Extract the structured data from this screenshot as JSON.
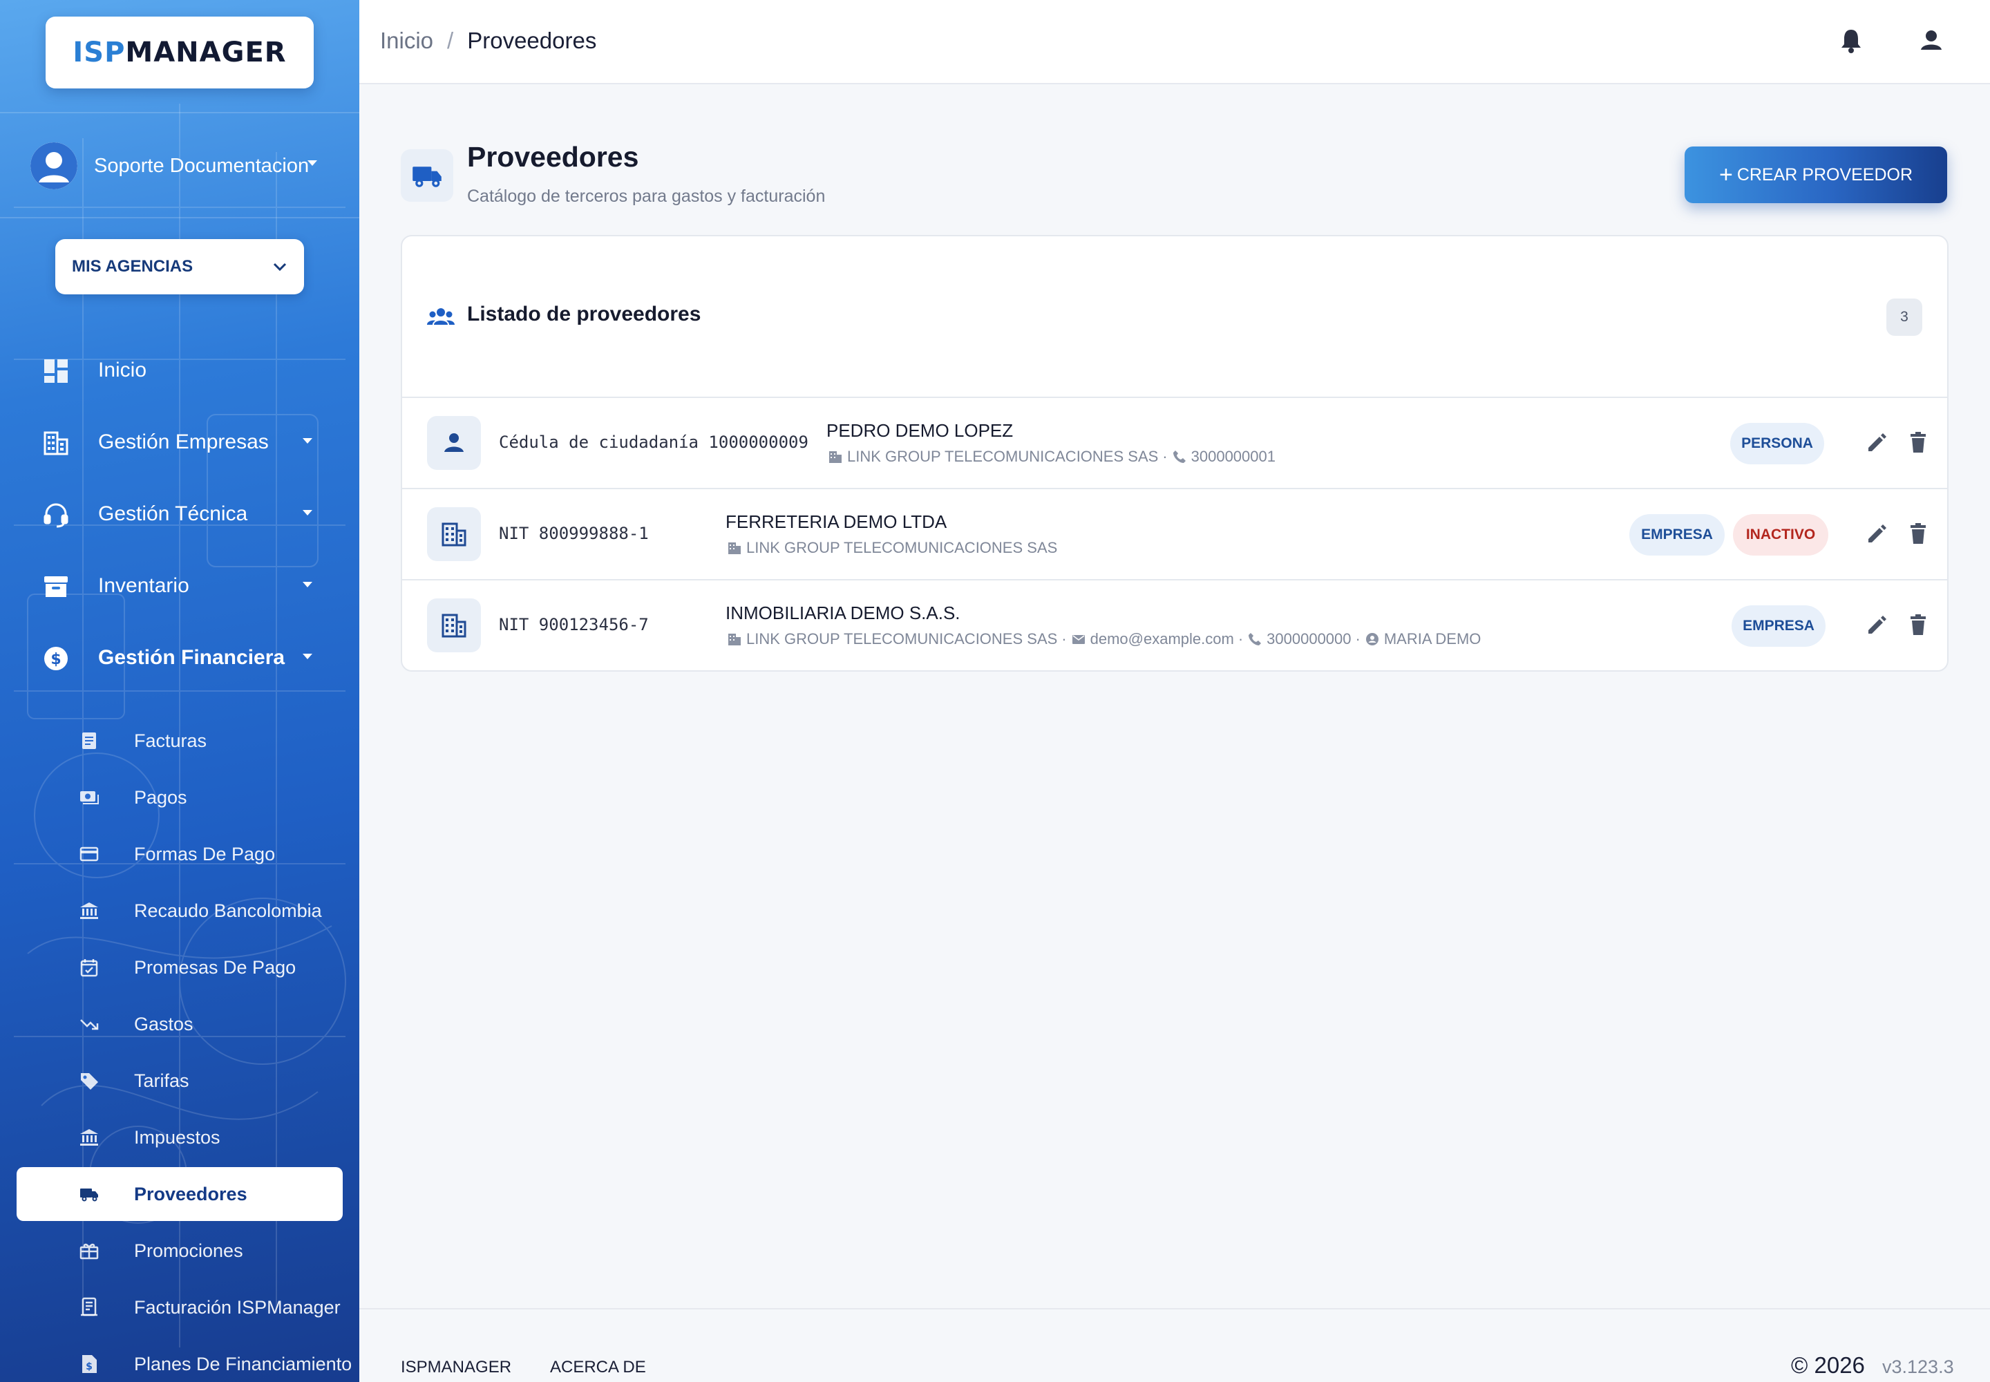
{
  "brand": {
    "logo_isp": "ISP",
    "logo_manager": "MANAGER"
  },
  "user": {
    "name": "Soporte Documentacion"
  },
  "agency": {
    "label": "MIS AGENCIAS"
  },
  "nav": {
    "inicio": "Inicio",
    "gestion_empresas": "Gestión Empresas",
    "gestion_tecnica": "Gestión Técnica",
    "inventario": "Inventario",
    "gestion_financiera": "Gestión Financiera"
  },
  "subnav": [
    {
      "label": "Facturas",
      "icon": "receipt-icon"
    },
    {
      "label": "Pagos",
      "icon": "payments-icon"
    },
    {
      "label": "Formas De Pago",
      "icon": "credit-card-icon"
    },
    {
      "label": "Recaudo Bancolombia",
      "icon": "bank-icon"
    },
    {
      "label": "Promesas De Pago",
      "icon": "calendar-check-icon"
    },
    {
      "label": "Gastos",
      "icon": "trending-down-icon"
    },
    {
      "label": "Tarifas",
      "icon": "tag-icon"
    },
    {
      "label": "Impuestos",
      "icon": "bank-icon"
    },
    {
      "label": "Proveedores",
      "icon": "truck-icon",
      "active": true
    },
    {
      "label": "Promociones",
      "icon": "gift-icon"
    },
    {
      "label": "Facturación ISPManager",
      "icon": "invoice-icon"
    },
    {
      "label": "Planes De Financiamiento",
      "icon": "dollar-document-icon"
    }
  ],
  "topbar": {
    "breadcrumb_home": "Inicio",
    "breadcrumb_sep": "/",
    "breadcrumb_current": "Proveedores"
  },
  "page": {
    "title": "Proveedores",
    "subtitle": "Catálogo de terceros para gastos y facturación",
    "create_button": "CREAR PROVEEDOR",
    "create_plus": "+"
  },
  "list": {
    "title": "Listado de proveedores",
    "count": "3",
    "rows": [
      {
        "type_icon": "person-icon",
        "document": "Cédula de ciudadanía 1000000009",
        "name": "PEDRO DEMO LOPEZ",
        "company": "LINK GROUP TELECOMUNICACIONES SAS",
        "phone": "3000000001",
        "badges": [
          "PERSONA"
        ]
      },
      {
        "type_icon": "building-icon",
        "document": "NIT 800999888-1",
        "name": "FERRETERIA DEMO LTDA",
        "company": "LINK GROUP TELECOMUNICACIONES SAS",
        "badges": [
          "EMPRESA",
          "INACTIVO"
        ]
      },
      {
        "type_icon": "building-icon",
        "document": "NIT 900123456-7",
        "name": "INMOBILIARIA DEMO S.A.S.",
        "company": "LINK GROUP TELECOMUNICACIONES SAS",
        "email": "demo@example.com",
        "phone": "3000000000",
        "contact": "MARIA DEMO",
        "badges": [
          "EMPRESA"
        ]
      }
    ],
    "meta_separator": "·"
  },
  "footer": {
    "link1": "ISPMANAGER",
    "link2": "ACERCA DE",
    "copyright": "© 2026",
    "version": "v3.123.3"
  },
  "colors": {
    "sidebar_top": "#5aa8ee",
    "sidebar_bottom": "#173c8f",
    "accent": "#1e4e98",
    "danger": "#b3261e",
    "background": "#f5f7fa"
  }
}
